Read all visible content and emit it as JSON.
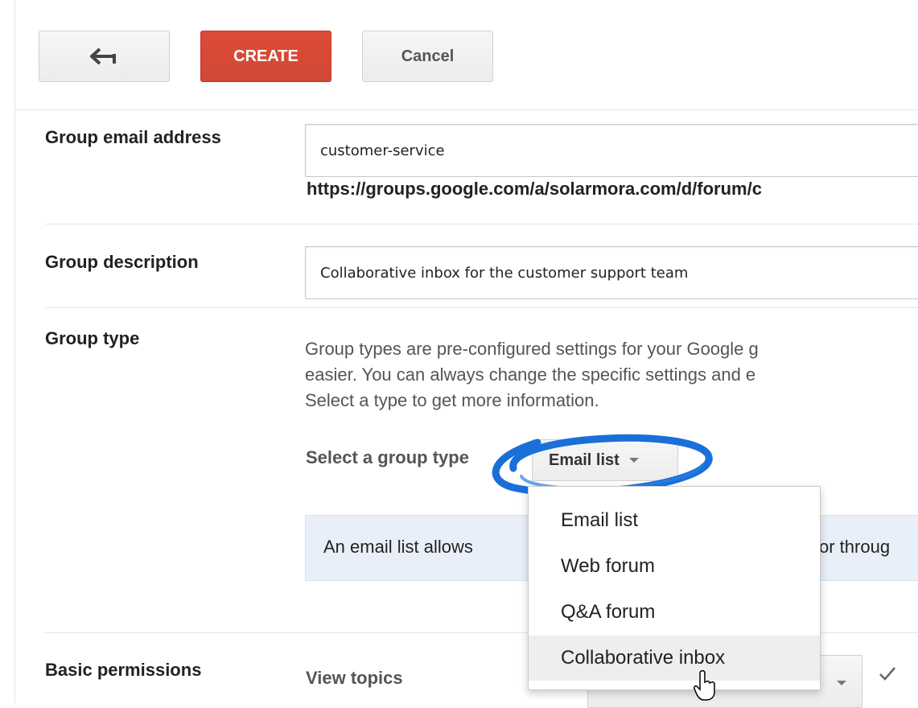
{
  "toolbar": {
    "back_icon": "back-arrow-icon",
    "create_label": "CREATE",
    "cancel_label": "Cancel"
  },
  "form": {
    "email": {
      "label": "Group email address",
      "value": "customer-service",
      "url": "https://groups.google.com/a/solarmora.com/d/forum/c"
    },
    "description": {
      "label": "Group description",
      "value": "Collaborative inbox for the customer support team"
    },
    "group_type": {
      "label": "Group type",
      "help_lines": [
        "Group types are pre-configured settings for your Google g",
        "easier. You can always change the specific settings and e",
        "Select a type to get more information."
      ],
      "select_label": "Select a group type",
      "selected": "Email list",
      "info_left": "An email list allows",
      "info_right": "or throug"
    },
    "permissions": {
      "label": "Basic permissions",
      "view_topics": "View topics"
    }
  },
  "menu": {
    "items": [
      "Email list",
      "Web forum",
      "Q&A forum",
      "Collaborative inbox"
    ],
    "hovered_index": 3
  },
  "colors": {
    "create_button": "#d14836",
    "annotation_circle": "#1a6fd8",
    "info_box": "#e9eff9"
  },
  "icons": {
    "check": "checkmark-icon",
    "cursor": "hand-cursor-icon"
  }
}
